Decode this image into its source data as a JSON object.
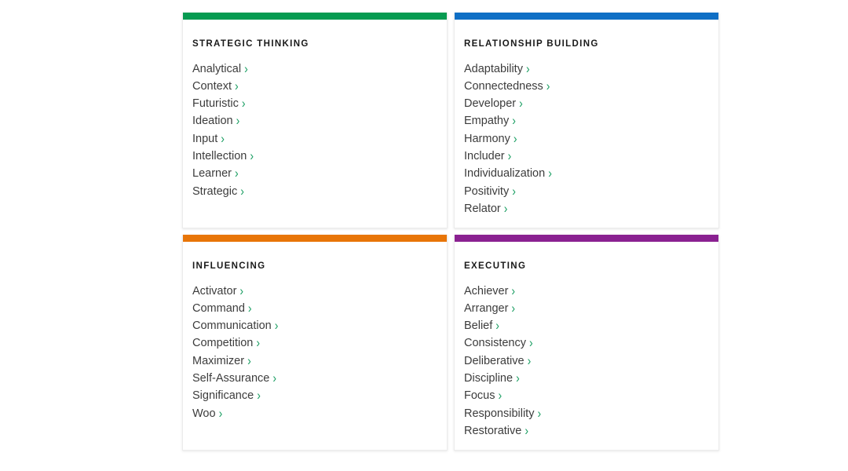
{
  "page": {
    "background_color": "#ffffff",
    "chevron_color": "#1a9e62",
    "text_color": "#3c3c3c",
    "chevron_glyph": "›"
  },
  "cards": [
    {
      "id": "strategic-thinking",
      "title": "STRATEGIC THINKING",
      "accent_color": "#069b51",
      "items": [
        {
          "label": "Analytical",
          "icon": "chevron-right-icon"
        },
        {
          "label": "Context",
          "icon": "chevron-right-icon"
        },
        {
          "label": "Futuristic",
          "icon": "chevron-right-icon"
        },
        {
          "label": "Ideation",
          "icon": "chevron-right-icon"
        },
        {
          "label": "Input",
          "icon": "chevron-right-icon"
        },
        {
          "label": "Intellection",
          "icon": "chevron-right-icon"
        },
        {
          "label": "Learner",
          "icon": "chevron-right-icon"
        },
        {
          "label": "Strategic",
          "icon": "chevron-right-icon"
        }
      ]
    },
    {
      "id": "relationship-building",
      "title": "RELATIONSHIP BUILDING",
      "accent_color": "#0f6fc5",
      "items": [
        {
          "label": "Adaptability",
          "icon": "chevron-right-icon"
        },
        {
          "label": "Connectedness",
          "icon": "chevron-right-icon"
        },
        {
          "label": "Developer",
          "icon": "chevron-right-icon"
        },
        {
          "label": "Empathy",
          "icon": "chevron-right-icon"
        },
        {
          "label": "Harmony",
          "icon": "chevron-right-icon"
        },
        {
          "label": "Includer",
          "icon": "chevron-right-icon"
        },
        {
          "label": "Individualization",
          "icon": "chevron-right-icon"
        },
        {
          "label": "Positivity",
          "icon": "chevron-right-icon"
        },
        {
          "label": "Relator",
          "icon": "chevron-right-icon"
        }
      ]
    },
    {
      "id": "influencing",
      "title": "INFLUENCING",
      "accent_color": "#e87508",
      "items": [
        {
          "label": "Activator",
          "icon": "chevron-right-icon"
        },
        {
          "label": "Command",
          "icon": "chevron-right-icon"
        },
        {
          "label": "Communication",
          "icon": "chevron-right-icon"
        },
        {
          "label": "Competition",
          "icon": "chevron-right-icon"
        },
        {
          "label": "Maximizer",
          "icon": "chevron-right-icon"
        },
        {
          "label": "Self-Assurance",
          "icon": "chevron-right-icon"
        },
        {
          "label": "Significance",
          "icon": "chevron-right-icon"
        },
        {
          "label": "Woo",
          "icon": "chevron-right-icon"
        }
      ]
    },
    {
      "id": "executing",
      "title": "EXECUTING",
      "accent_color": "#8a2191",
      "items": [
        {
          "label": "Achiever",
          "icon": "chevron-right-icon"
        },
        {
          "label": "Arranger",
          "icon": "chevron-right-icon"
        },
        {
          "label": "Belief",
          "icon": "chevron-right-icon"
        },
        {
          "label": "Consistency",
          "icon": "chevron-right-icon"
        },
        {
          "label": "Deliberative",
          "icon": "chevron-right-icon"
        },
        {
          "label": "Discipline",
          "icon": "chevron-right-icon"
        },
        {
          "label": "Focus",
          "icon": "chevron-right-icon"
        },
        {
          "label": "Responsibility",
          "icon": "chevron-right-icon"
        },
        {
          "label": "Restorative",
          "icon": "chevron-right-icon"
        }
      ]
    }
  ]
}
